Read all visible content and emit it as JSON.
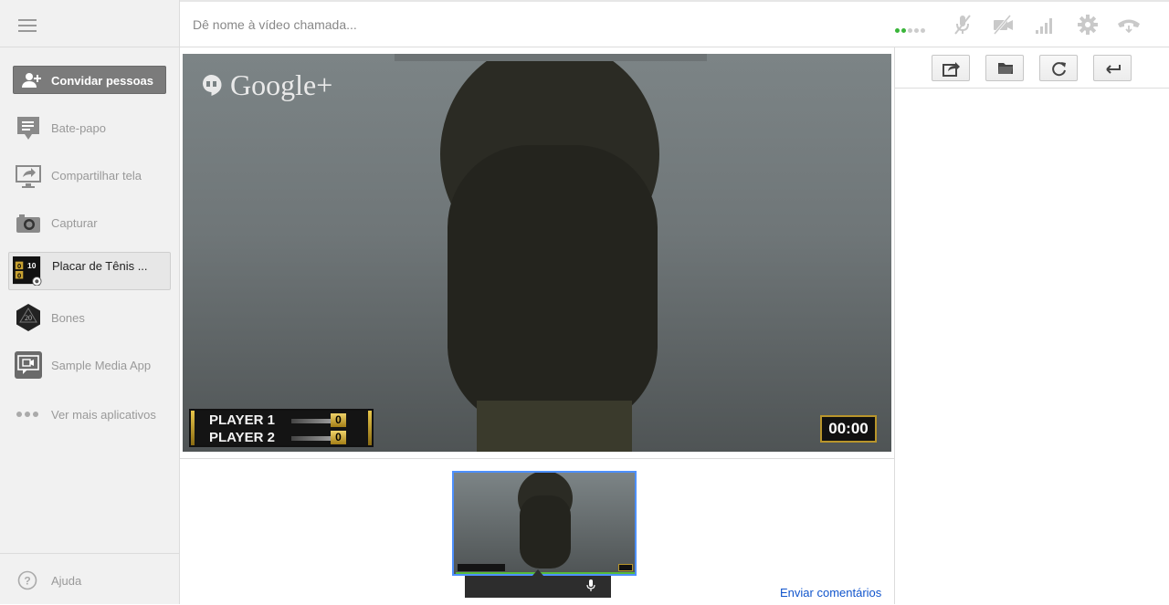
{
  "header": {
    "title_placeholder": "Dê nome à vídeo chamada..."
  },
  "sidebar": {
    "invite_label": "Convidar pessoas",
    "items": [
      {
        "label": "Bate-papo",
        "icon": "chat-icon"
      },
      {
        "label": "Compartilhar tela",
        "icon": "screen-share-icon"
      },
      {
        "label": "Capturar",
        "icon": "camera-icon"
      },
      {
        "label": "Placar de Tênis ...",
        "icon": "tennis-scoreboard-app-icon",
        "active": true
      },
      {
        "label": "Bones",
        "icon": "bones-d20-icon"
      },
      {
        "label": "Sample Media App",
        "icon": "media-app-icon"
      },
      {
        "label": "Ver mais aplicativos",
        "icon": "more-dots-icon"
      }
    ],
    "help_label": "Ajuda",
    "app_thumb_score": "10"
  },
  "video": {
    "brand": "Google+",
    "scoreboard": {
      "player1": "PLAYER 1",
      "player2": "PLAYER 2",
      "score1": "0",
      "score2": "0"
    },
    "timer": "00:00"
  },
  "footer": {
    "feedback_label": "Enviar comentários"
  },
  "colors": {
    "accent_blue": "#4d90fe",
    "status_green": "#3ab53a",
    "link_blue": "#1155cc",
    "gold": "#c8a232"
  }
}
